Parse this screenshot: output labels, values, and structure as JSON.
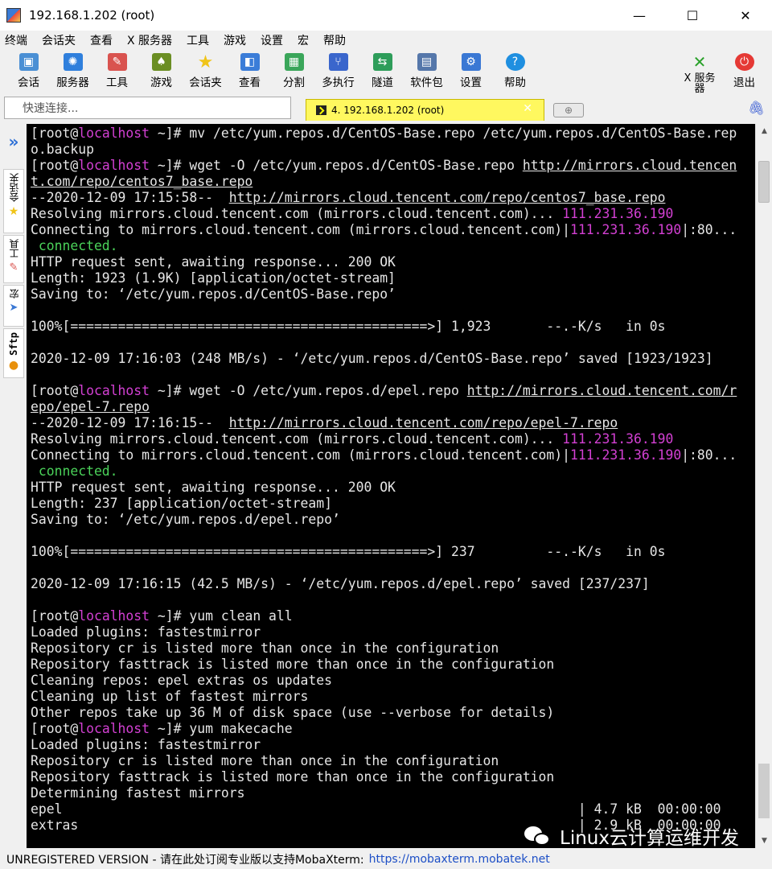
{
  "window": {
    "title": "192.168.1.202 (root)",
    "minimize": "—",
    "maximize": "☐",
    "close": "✕"
  },
  "menu": [
    "终端",
    "会话夹",
    "查看",
    "X 服务器",
    "工具",
    "游戏",
    "设置",
    "宏",
    "帮助"
  ],
  "toolbar": {
    "items": [
      {
        "label": "会话",
        "icon": "session-icon",
        "color": "#4a8fd4"
      },
      {
        "label": "服务器",
        "icon": "servers-icon",
        "color": "#2f7fdc"
      },
      {
        "label": "工具",
        "icon": "tools-icon",
        "color": "#d9534f"
      },
      {
        "label": "游戏",
        "icon": "games-icon",
        "color": "#6b8e23"
      },
      {
        "label": "会话夹",
        "icon": "star-icon",
        "color": "#f0c419"
      },
      {
        "label": "查看",
        "icon": "view-icon",
        "color": "#3b7dd8"
      },
      {
        "label": "分割",
        "icon": "split-icon",
        "color": "#3aa65a"
      },
      {
        "label": "多执行",
        "icon": "multiexec-icon",
        "color": "#3a66cc"
      },
      {
        "label": "隧道",
        "icon": "tunnel-icon",
        "color": "#2e9d5a"
      },
      {
        "label": "软件包",
        "icon": "packages-icon",
        "color": "#5577aa"
      },
      {
        "label": "设置",
        "icon": "settings-icon",
        "color": "#3a78d4"
      },
      {
        "label": "帮助",
        "icon": "help-icon",
        "color": "#1f8fe0"
      }
    ],
    "xserver_label": "X 服务器",
    "exit_label": "退出"
  },
  "quick_connect": {
    "placeholder": "快速连接..."
  },
  "tab": {
    "label": "4. 192.168.1.202 (root)",
    "close": "✕",
    "new_tab": "⊕"
  },
  "sidebar": {
    "items": [
      "会话夹",
      "工具",
      "宏",
      "Sftp"
    ]
  },
  "terminal": {
    "lines": [
      [
        [
          "[root@",
          ""
        ],
        [
          "localhost",
          "host"
        ],
        [
          " ~]# mv /etc/yum.repos.d/CentOS-Base.repo /etc/yum.repos.d/CentOS-Base.rep",
          ""
        ]
      ],
      [
        [
          "o.backup",
          ""
        ]
      ],
      [
        [
          "[root@",
          ""
        ],
        [
          "localhost",
          "host"
        ],
        [
          " ~]# wget -O /etc/yum.repos.d/CentOS-Base.repo ",
          ""
        ],
        [
          "http://mirrors.cloud.tencen",
          "url"
        ]
      ],
      [
        [
          "t.com/repo/centos7_base.repo",
          "url"
        ]
      ],
      [
        [
          "--2020-12-09 17:15:58--  ",
          ""
        ],
        [
          "http://mirrors.cloud.tencent.com/repo/centos7_base.repo",
          "url"
        ]
      ],
      [
        [
          "Resolving mirrors.cloud.tencent.com (mirrors.cloud.tencent.com)... ",
          ""
        ],
        [
          "111.231.36.190",
          "ip"
        ]
      ],
      [
        [
          "Connecting to mirrors.cloud.tencent.com (mirrors.cloud.tencent.com)|",
          ""
        ],
        [
          "111.231.36.190",
          "ip"
        ],
        [
          "|:80...",
          ""
        ]
      ],
      [
        [
          " connected.",
          "green"
        ]
      ],
      [
        [
          "HTTP request sent, awaiting response... 200 OK",
          ""
        ]
      ],
      [
        [
          "Length: 1923 (1.9K) [application/octet-stream]",
          ""
        ]
      ],
      [
        [
          "Saving to: ‘/etc/yum.repos.d/CentOS-Base.repo’",
          ""
        ]
      ],
      [
        [
          "",
          ""
        ]
      ],
      [
        [
          "100%[=============================================>] 1,923       --.-K/s   in 0s",
          ""
        ]
      ],
      [
        [
          "",
          ""
        ]
      ],
      [
        [
          "2020-12-09 17:16:03 (248 MB/s) - ‘/etc/yum.repos.d/CentOS-Base.repo’ saved [1923/1923]",
          ""
        ]
      ],
      [
        [
          "",
          ""
        ]
      ],
      [
        [
          "[root@",
          ""
        ],
        [
          "localhost",
          "host"
        ],
        [
          " ~]# wget -O /etc/yum.repos.d/epel.repo ",
          ""
        ],
        [
          "http://mirrors.cloud.tencent.com/r",
          "url"
        ]
      ],
      [
        [
          "epo/epel-7.repo",
          "url"
        ]
      ],
      [
        [
          "--2020-12-09 17:16:15--  ",
          ""
        ],
        [
          "http://mirrors.cloud.tencent.com/repo/epel-7.repo",
          "url"
        ]
      ],
      [
        [
          "Resolving mirrors.cloud.tencent.com (mirrors.cloud.tencent.com)... ",
          ""
        ],
        [
          "111.231.36.190",
          "ip"
        ]
      ],
      [
        [
          "Connecting to mirrors.cloud.tencent.com (mirrors.cloud.tencent.com)|",
          ""
        ],
        [
          "111.231.36.190",
          "ip"
        ],
        [
          "|:80...",
          ""
        ]
      ],
      [
        [
          " connected.",
          "green"
        ]
      ],
      [
        [
          "HTTP request sent, awaiting response... 200 OK",
          ""
        ]
      ],
      [
        [
          "Length: 237 [application/octet-stream]",
          ""
        ]
      ],
      [
        [
          "Saving to: ‘/etc/yum.repos.d/epel.repo’",
          ""
        ]
      ],
      [
        [
          "",
          ""
        ]
      ],
      [
        [
          "100%[=============================================>] 237         --.-K/s   in 0s",
          ""
        ]
      ],
      [
        [
          "",
          ""
        ]
      ],
      [
        [
          "2020-12-09 17:16:15 (42.5 MB/s) - ‘/etc/yum.repos.d/epel.repo’ saved [237/237]",
          ""
        ]
      ],
      [
        [
          "",
          ""
        ]
      ],
      [
        [
          "[root@",
          ""
        ],
        [
          "localhost",
          "host"
        ],
        [
          " ~]# yum clean all",
          ""
        ]
      ],
      [
        [
          "Loaded plugins: fastestmirror",
          ""
        ]
      ],
      [
        [
          "Repository cr is listed more than once in the configuration",
          ""
        ]
      ],
      [
        [
          "Repository fasttrack is listed more than once in the configuration",
          ""
        ]
      ],
      [
        [
          "Cleaning repos: epel extras os updates",
          ""
        ]
      ],
      [
        [
          "Cleaning up list of fastest mirrors",
          ""
        ]
      ],
      [
        [
          "Other repos take up 36 M of disk space (use --verbose for details)",
          ""
        ]
      ],
      [
        [
          "[root@",
          ""
        ],
        [
          "localhost",
          "host"
        ],
        [
          " ~]# yum makecache",
          ""
        ]
      ],
      [
        [
          "Loaded plugins: fastestmirror",
          ""
        ]
      ],
      [
        [
          "Repository cr is listed more than once in the configuration",
          ""
        ]
      ],
      [
        [
          "Repository fasttrack is listed more than once in the configuration",
          ""
        ]
      ],
      [
        [
          "Determining fastest mirrors",
          ""
        ]
      ],
      [
        [
          "epel                                                                 | 4.7 kB  00:00:00",
          ""
        ]
      ],
      [
        [
          "extras                                                               | 2.9 kB  00:00:00",
          ""
        ]
      ]
    ]
  },
  "statusbar": {
    "text": "UNREGISTERED VERSION  -  请在此处订阅专业版以支持MobaXterm:",
    "link": "https://mobaxterm.mobatek.net"
  },
  "watermark": {
    "text": "Linux云计算运维开发"
  }
}
